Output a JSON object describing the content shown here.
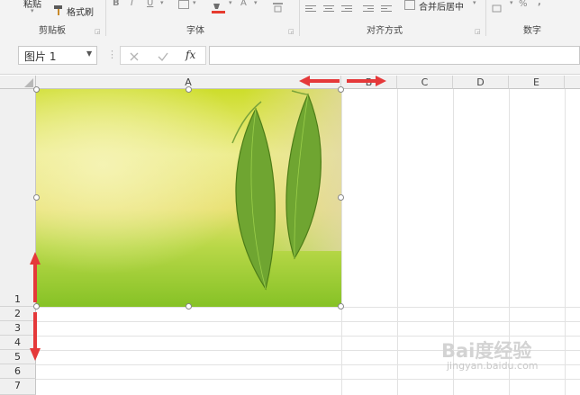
{
  "ribbon": {
    "paste_label": "粘贴",
    "format_painter_label": "格式刷",
    "bold_label": "B",
    "italic_label": "I",
    "underline_label": "U",
    "font_color_label": "A",
    "group_clipboard": "剪贴板",
    "group_font": "字体",
    "group_alignment": "对齐方式",
    "group_number": "数字",
    "merge_center_label": "合并后居中",
    "percent_label": "%"
  },
  "formula_bar": {
    "name_box_value": "图片 1",
    "fx_label": "fx"
  },
  "sheet": {
    "columns": [
      "A",
      "B",
      "C",
      "D",
      "E"
    ],
    "rows": [
      "1",
      "2",
      "3",
      "4",
      "5",
      "6",
      "7"
    ]
  },
  "watermark": {
    "brand": "Bai度经验",
    "url": "jingyan.baidu.com"
  },
  "colors": {
    "arrow": "#e5393a",
    "image_leaf": "#6fa531"
  }
}
